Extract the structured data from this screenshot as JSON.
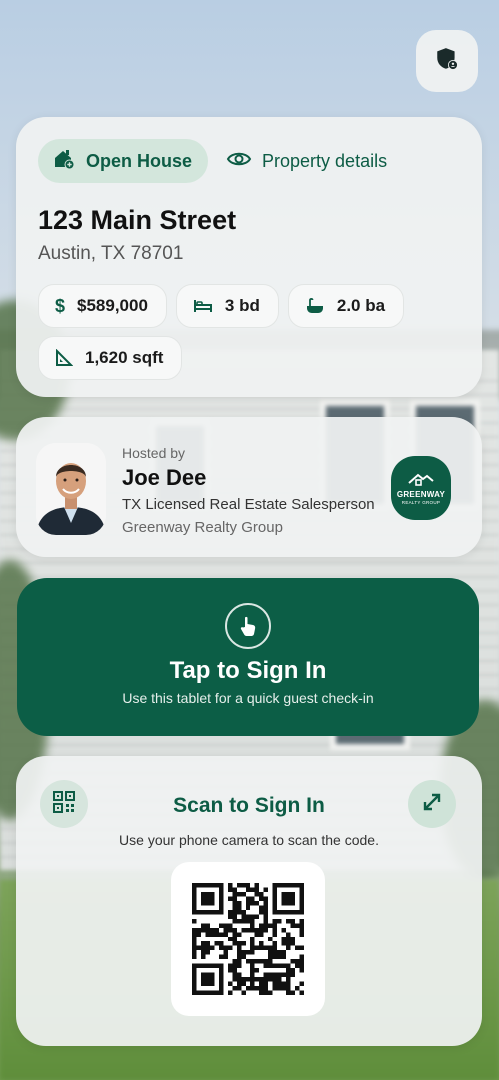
{
  "header": {
    "shield_icon": "shield-user-icon"
  },
  "property": {
    "tab_open_house": "Open House",
    "tab_details": "Property details",
    "address": "123 Main Street",
    "city": "Austin, TX 78701",
    "price": "$589,000",
    "beds": "3 bd",
    "baths": "2.0 ba",
    "sqft": "1,620 sqft"
  },
  "host": {
    "label": "Hosted by",
    "name": "Joe Dee",
    "license": "TX Licensed Real Estate Salesperson",
    "brokerage": "Greenway Realty Group",
    "logo_line1": "GREENWAY",
    "logo_line2": "REALTY GROUP"
  },
  "tap_signin": {
    "title": "Tap to Sign In",
    "subtitle": "Use this tablet for a quick guest check-in"
  },
  "scan_signin": {
    "title": "Scan to Sign In",
    "subtitle": "Use your phone camera to scan the code."
  },
  "colors": {
    "brand_green": "#0c5e46",
    "chip_green_bg": "#d3e6dc"
  }
}
